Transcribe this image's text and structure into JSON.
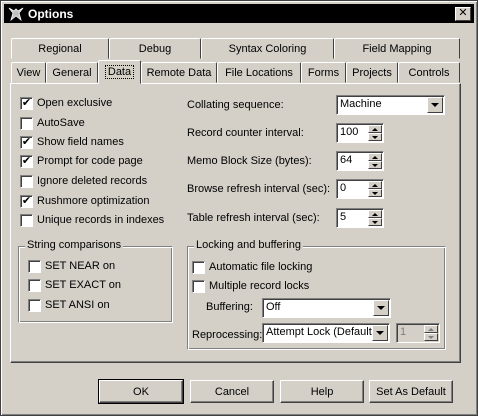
{
  "window": {
    "title": "Options",
    "close_glyph": "✕"
  },
  "tabs_row1": [
    {
      "label": "Regional"
    },
    {
      "label": "Debug"
    },
    {
      "label": "Syntax Coloring"
    },
    {
      "label": "Field Mapping"
    }
  ],
  "tabs_row2": [
    {
      "label": "View"
    },
    {
      "label": "General"
    },
    {
      "label": "Data",
      "active": true
    },
    {
      "label": "Remote Data"
    },
    {
      "label": "File Locations"
    },
    {
      "label": "Forms"
    },
    {
      "label": "Projects"
    },
    {
      "label": "Controls"
    }
  ],
  "options": {
    "open_exclusive": {
      "label": "Open exclusive",
      "checked": true
    },
    "autosave": {
      "label": "AutoSave",
      "checked": false
    },
    "show_field_names": {
      "label": "Show field names",
      "checked": true
    },
    "prompt_code_page": {
      "label": "Prompt for code page",
      "checked": true
    },
    "ignore_deleted": {
      "label": "Ignore deleted records",
      "checked": false
    },
    "rushmore": {
      "label": "Rushmore optimization",
      "checked": true
    },
    "unique_records": {
      "label": "Unique records in indexes",
      "checked": false
    }
  },
  "string_comparisons": {
    "title": "String comparisons",
    "set_near": {
      "label": "SET NEAR on",
      "checked": false
    },
    "set_exact": {
      "label": "SET EXACT on",
      "checked": false
    },
    "set_ansi": {
      "label": "SET ANSI on",
      "checked": false
    }
  },
  "settings": {
    "collating_label": "Collating sequence:",
    "collating_value": "Machine",
    "record_counter_label": "Record counter interval:",
    "record_counter_value": "100",
    "memo_block_label": "Memo Block Size (bytes):",
    "memo_block_value": "64",
    "browse_refresh_label": "Browse refresh interval (sec):",
    "browse_refresh_value": "0",
    "table_refresh_label": "Table refresh interval (sec):",
    "table_refresh_value": "5"
  },
  "locking": {
    "title": "Locking and buffering",
    "auto_file_locking": {
      "label": "Automatic file locking",
      "checked": false
    },
    "multiple_record_locks": {
      "label": "Multiple record locks",
      "checked": false
    },
    "buffering_label": "Buffering:",
    "buffering_value": "Off",
    "reprocessing_label": "Reprocessing:",
    "reprocessing_value": "Attempt Lock (Default)",
    "reprocessing_count": "1"
  },
  "buttons": {
    "ok": "OK",
    "cancel": "Cancel",
    "help": "Help",
    "set_default": "Set As Default"
  },
  "colors": {
    "titlebar": "#000000",
    "face": "#d4d0c8"
  },
  "check_glyph": "✔"
}
